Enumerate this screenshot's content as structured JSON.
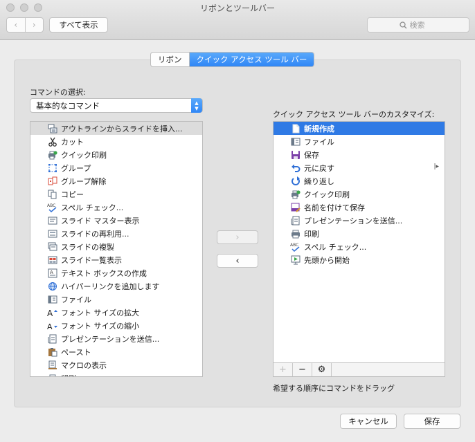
{
  "window": {
    "title": "リボンとツールバー"
  },
  "toolbar": {
    "back_glyph": "‹",
    "forward_glyph": "›",
    "show_all": "すべて表示",
    "search_placeholder": "検索"
  },
  "tabs": [
    {
      "label": "リボン",
      "active": false
    },
    {
      "label": "クイック アクセス ツール バー",
      "active": true
    }
  ],
  "left": {
    "label": "コマンドの選択:",
    "select_value": "基本的なコマンド",
    "items": [
      {
        "label": "アウトラインからスライドを挿入...",
        "icon": "outline-icon"
      },
      {
        "label": "カット",
        "icon": "scissors-icon"
      },
      {
        "label": "クイック印刷",
        "icon": "quick-print-icon"
      },
      {
        "label": "グループ",
        "icon": "group-icon"
      },
      {
        "label": "グループ解除",
        "icon": "ungroup-icon"
      },
      {
        "label": "コピー",
        "icon": "copy-icon"
      },
      {
        "label": "スペル チェック...",
        "icon": "spellcheck-icon"
      },
      {
        "label": "スライド マスター表示",
        "icon": "slide-master-icon"
      },
      {
        "label": "スライドの再利用...",
        "icon": "reuse-slide-icon"
      },
      {
        "label": "スライドの複製",
        "icon": "duplicate-slide-icon"
      },
      {
        "label": "スライド一覧表示",
        "icon": "slide-sorter-icon"
      },
      {
        "label": "テキスト ボックスの作成",
        "icon": "textbox-icon"
      },
      {
        "label": "ハイパーリンクを追加します",
        "icon": "hyperlink-icon"
      },
      {
        "label": "ファイル",
        "icon": "file-icon"
      },
      {
        "label": "フォント サイズの拡大",
        "icon": "font-grow-icon"
      },
      {
        "label": "フォント サイズの縮小",
        "icon": "font-shrink-icon"
      },
      {
        "label": "プレゼンテーションを送信...",
        "icon": "send-icon"
      },
      {
        "label": "ペースト",
        "icon": "paste-icon"
      },
      {
        "label": "マクロの表示",
        "icon": "macro-icon"
      },
      {
        "label": "印刷",
        "icon": "print-icon"
      }
    ]
  },
  "right": {
    "label": "クイック アクセス ツール バーのカスタマイズ:",
    "items": [
      {
        "label": "新規作成",
        "icon": "new-document-icon",
        "selected": true
      },
      {
        "label": "ファイル",
        "icon": "file-icon"
      },
      {
        "label": "保存",
        "icon": "save-icon"
      },
      {
        "label": "元に戻す",
        "icon": "undo-icon",
        "submenu": true
      },
      {
        "label": "繰り返し",
        "icon": "redo-icon"
      },
      {
        "label": "クイック印刷",
        "icon": "quick-print-icon"
      },
      {
        "label": "名前を付けて保存",
        "icon": "save-as-icon"
      },
      {
        "label": "プレゼンテーションを送信...",
        "icon": "send-icon"
      },
      {
        "label": "印刷",
        "icon": "print-icon"
      },
      {
        "label": "スペル チェック...",
        "icon": "spellcheck-icon"
      },
      {
        "label": "先頭から開始",
        "icon": "slideshow-start-icon"
      }
    ],
    "hint": "希望する順序にコマンドをドラッグ"
  },
  "move": {
    "add_glyph": "›",
    "remove_glyph": "‹"
  },
  "listbar": {
    "add": "+",
    "remove": "−",
    "gear": "⚙"
  },
  "footer": {
    "cancel": "キャンセル",
    "save": "保存"
  },
  "colors": {
    "accent": "#2f7ae5",
    "selection_gray": "#dcdcdc",
    "background": "#ececec"
  }
}
